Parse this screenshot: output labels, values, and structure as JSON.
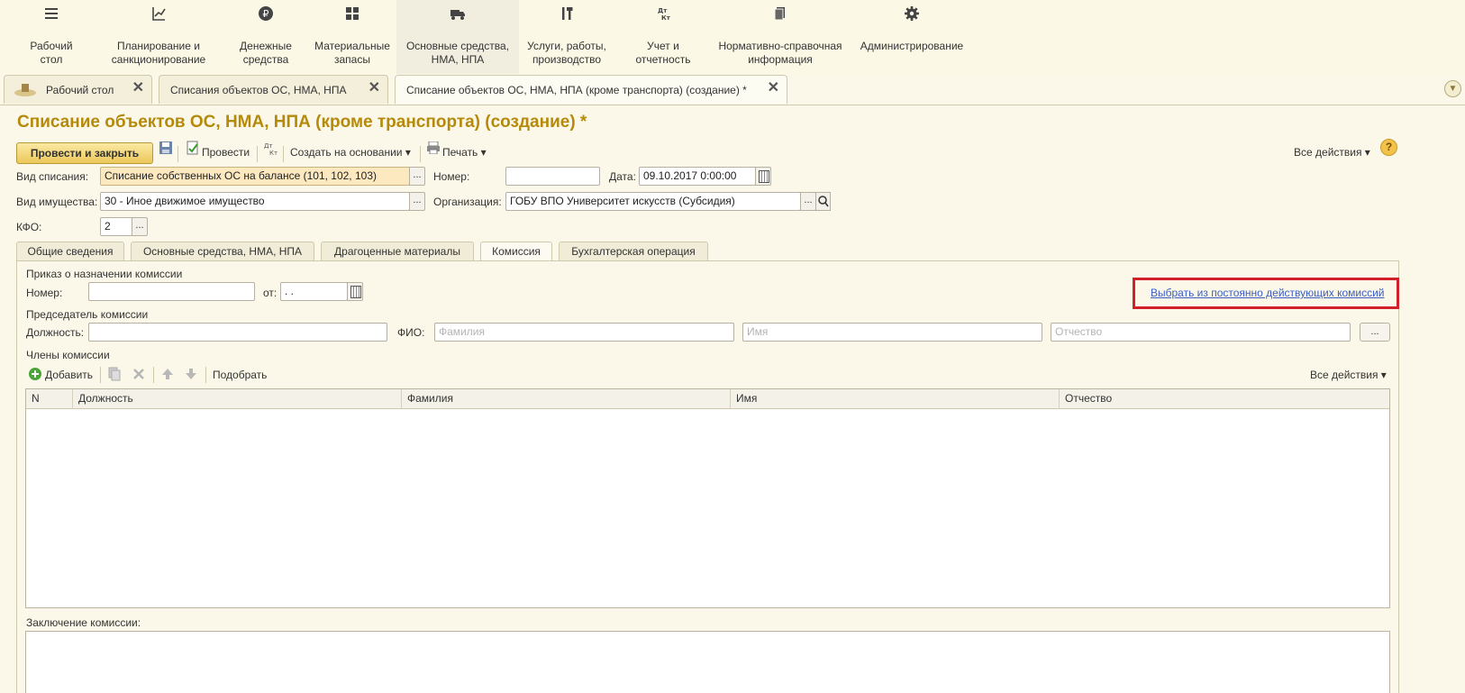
{
  "sections": [
    {
      "label": "Рабочий\nстол",
      "icon": "menu-icon"
    },
    {
      "label": "Планирование и\nсанкционирование",
      "icon": "planning-icon"
    },
    {
      "label": "Денежные\nсредства",
      "icon": "ruble-icon"
    },
    {
      "label": "Материальные\nзапасы",
      "icon": "grid-icon"
    },
    {
      "label": "Основные средства,\nНМА, НПА",
      "icon": "truck-icon"
    },
    {
      "label": "Услуги, работы,\nпроизводство",
      "icon": "tools-icon"
    },
    {
      "label": "Учет и\nотчетность",
      "icon": "dt-kt-icon"
    },
    {
      "label": "Нормативно-справочная\nинформация",
      "icon": "books-icon"
    },
    {
      "label": "Администрирование",
      "icon": "gear-icon"
    }
  ],
  "window_tabs": [
    {
      "label": "Рабочий стол",
      "close": "✕"
    },
    {
      "label": "Списания объектов ОС, НМА, НПА",
      "close": "✕"
    },
    {
      "label": "Списание объектов ОС, НМА, НПА (кроме транспорта) (создание) *",
      "close": "✕"
    }
  ],
  "form": {
    "title": "Списание объектов ОС, НМА, НПА (кроме транспорта) (создание) *",
    "toolbar": {
      "post_close": "Провести и закрыть",
      "post": "Провести",
      "create_based": "Создать на основании",
      "print": "Печать",
      "all_actions": "Все действия",
      "help": "?"
    },
    "fields": {
      "writeoff_type_label": "Вид списания:",
      "writeoff_type_value": "Списание собственных ОС на балансе (101, 102, 103)",
      "number_label": "Номер:",
      "number_value": "",
      "date_label": "Дата:",
      "date_value": "09.10.2017  0:00:00",
      "property_type_label": "Вид имущества:",
      "property_type_value": "30 - Иное движимое имущество",
      "org_label": "Организация:",
      "org_value": "ГОБУ ВПО Университет искусств (Субсидия)",
      "kfo_label": "КФО:",
      "kfo_value": "2",
      "dots": "..."
    },
    "tabs": [
      "Общие сведения",
      "Основные средства, НМА, НПА",
      "Драгоценные материалы",
      "Комиссия",
      "Бухгалтерская операция"
    ],
    "commission": {
      "order_header": "Приказ о назначении комиссии",
      "order_number_label": "Номер:",
      "order_number_value": "",
      "order_from_label": "от:",
      "order_from_value": " .  .",
      "select_link": "Выбрать из постоянно действующих комиссий",
      "chairman_header": "Председатель комиссии",
      "position_label": "Должность:",
      "position_value": "",
      "fio_label": "ФИО:",
      "surname_placeholder": "Фамилия",
      "name_placeholder": "Имя",
      "patronymic_placeholder": "Отчество",
      "members_header": "Члены комиссии",
      "add": "Добавить",
      "pick": "Подобрать",
      "all_actions": "Все действия",
      "columns": [
        "N",
        "Должность",
        "Фамилия",
        "Имя",
        "Отчество"
      ],
      "rows": [],
      "conclusion_label": "Заключение комиссии:",
      "conclusion_value": ""
    }
  },
  "colors": {
    "title": "#b58a0a",
    "link": "#3a5ec4",
    "highlight": "#d0202a",
    "accent_button": "#ecc85b"
  }
}
